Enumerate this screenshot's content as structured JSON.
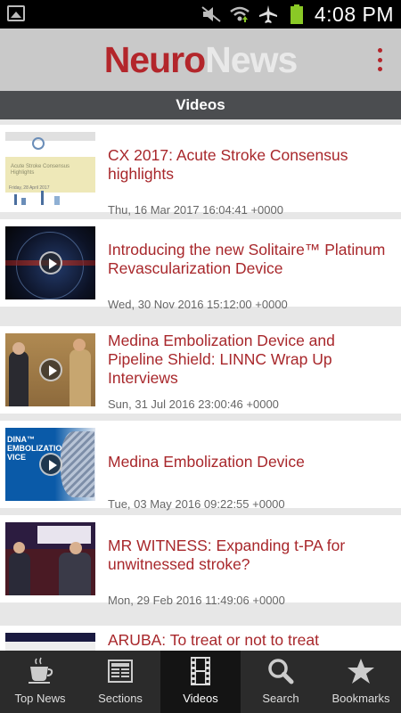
{
  "status_bar": {
    "time": "4:08 PM"
  },
  "header": {
    "logo_part1": "Neuro",
    "logo_part2": "News"
  },
  "section": {
    "title": "Videos"
  },
  "videos": [
    {
      "title": "CX 2017: Acute Stroke Consensus highlights",
      "date": "Thu, 16 Mar 2017 16:04:41 +0000",
      "thumb_label": "Acute Stroke Consensus Highlights",
      "thumb_sub": "Friday, 28 April 2017"
    },
    {
      "title": "Introducing the new Solitaire™ Platinum Revascularization Device",
      "date": "Wed, 30 Nov 2016 15:12:00 +0000"
    },
    {
      "title": "Medina Embolization Device and Pipeline Shield: LINNC Wrap Up Interviews",
      "date": "Sun, 31 Jul 2016 23:00:46 +0000"
    },
    {
      "title": "Medina Embolization Device",
      "date": "Tue, 03 May 2016 09:22:55 +0000",
      "thumb_label": "DINA™ EMBOLIZATION VICE"
    },
    {
      "title": "MR WITNESS: Expanding t-PA for unwitnessed stroke?",
      "date": "Mon, 29 Feb 2016 11:49:06 +0000"
    },
    {
      "title": "ARUBA: To treat or not to treat",
      "date": ""
    }
  ],
  "nav": [
    {
      "label": "Top News",
      "icon": "coffee-cup-icon"
    },
    {
      "label": "Sections",
      "icon": "newspaper-icon"
    },
    {
      "label": "Videos",
      "icon": "film-icon"
    },
    {
      "label": "Search",
      "icon": "search-icon"
    },
    {
      "label": "Bookmarks",
      "icon": "star-icon"
    }
  ],
  "colors": {
    "brand_red": "#b3262b",
    "nav_bg": "#2b2b2b",
    "section_bar": "#4b4d50",
    "header_bg": "#c9c9c9"
  }
}
